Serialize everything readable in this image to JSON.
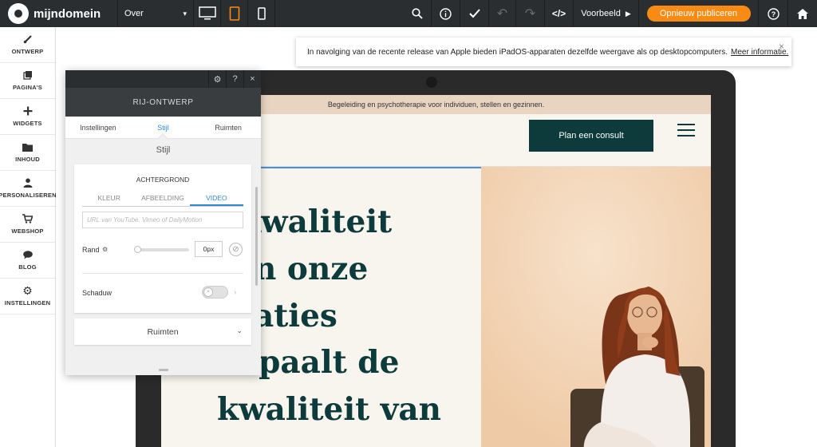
{
  "toolbar": {
    "brand": "mijndomein",
    "page_select": "Over",
    "preview_label": "Voorbeeld",
    "publish_label": "Opnieuw publiceren",
    "code_label": "</>"
  },
  "sidebar": {
    "items": [
      {
        "label": "ONTWERP",
        "icon": "brush-icon"
      },
      {
        "label": "PAGINA'S",
        "icon": "pages-icon"
      },
      {
        "label": "WIDGETS",
        "icon": "plus-icon"
      },
      {
        "label": "INHOUD",
        "icon": "folder-icon"
      },
      {
        "label": "PERSONALISEREN",
        "icon": "person-icon"
      },
      {
        "label": "WEBSHOP",
        "icon": "cart-icon"
      },
      {
        "label": "BLOG",
        "icon": "speech-bubble-icon"
      },
      {
        "label": "INSTELLINGEN",
        "icon": "gear-icon"
      }
    ]
  },
  "notice": {
    "text": "In navolging van de recente release van Apple bieden iPadOS-apparaten dezelfde weergave als op desktopcomputers.",
    "link": "Meer informatie.",
    "close": "×"
  },
  "panel": {
    "title": "RIJ-ONTWERP",
    "tabs": [
      "Instellingen",
      "Stijl",
      "Ruimten"
    ],
    "section_title": "Stijl",
    "background": {
      "title": "ACHTERGROND",
      "tabs": [
        "KLEUR",
        "AFBEELDING",
        "VIDEO"
      ],
      "url_placeholder": "URL van YouTube, Vimeo of DailyMotion"
    },
    "border": {
      "label": "Rand",
      "value": "0px"
    },
    "shadow": {
      "label": "Schaduw"
    },
    "spaces_label": "Ruimten",
    "help": "?",
    "close": "×"
  },
  "site": {
    "announcement": "Begeleiding en psychotherapie voor individuen, stellen en gezinnen.",
    "cta": "Plan een consult",
    "hero_lines": [
      "kwaliteit",
      "n onze",
      "aties",
      "bepaalt de",
      "kwaliteit van"
    ]
  },
  "colors": {
    "toolbar_bg": "#2b2e31",
    "accent_orange": "#f98a14",
    "active_blue": "#2d8ad6",
    "brand_green": "#0d3b3b",
    "announce_bar": "#e8d4c1",
    "hero_bg": "#f3d8bb"
  }
}
